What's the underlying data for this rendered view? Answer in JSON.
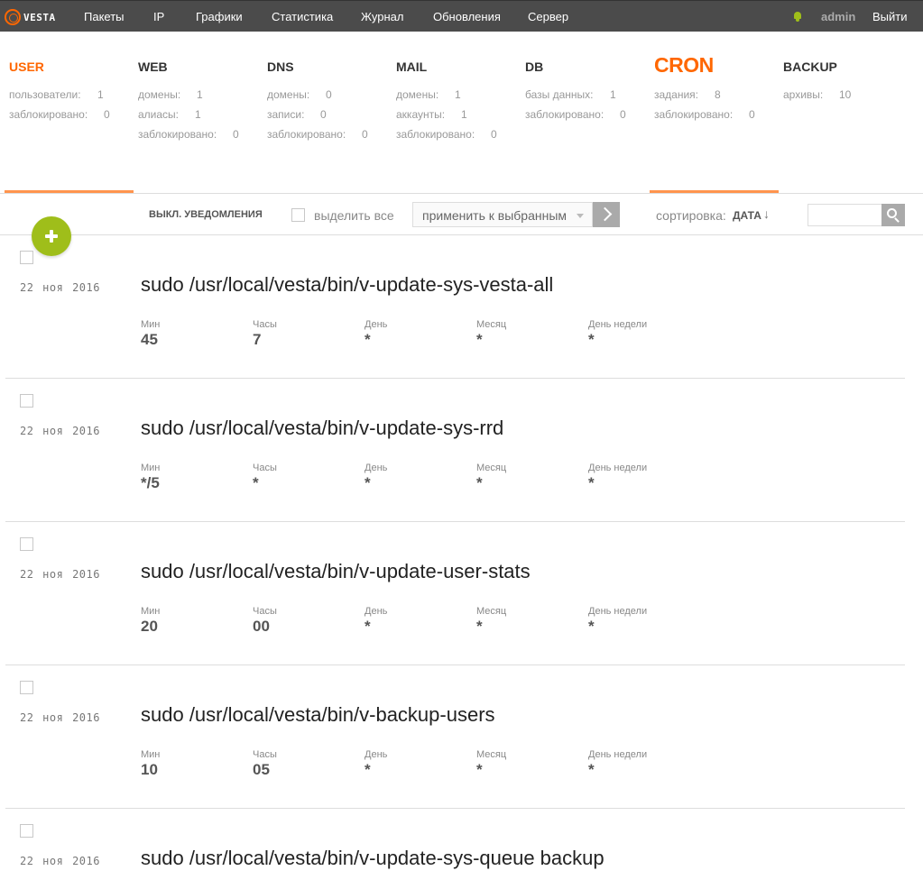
{
  "nav": {
    "logo": "VESTA",
    "items": [
      "Пакеты",
      "IP",
      "Графики",
      "Статистика",
      "Журнал",
      "Обновления",
      "Сервер"
    ],
    "user": "admin",
    "logout": "Выйти"
  },
  "panels": [
    {
      "title": "USER",
      "rows": [
        {
          "label": "пользователи:",
          "value": "1"
        },
        {
          "label": "заблокировано:",
          "value": "0"
        }
      ]
    },
    {
      "title": "WEB",
      "rows": [
        {
          "label": "домены:",
          "value": "1"
        },
        {
          "label": "алиасы:",
          "value": "1"
        },
        {
          "label": "заблокировано:",
          "value": "0"
        }
      ]
    },
    {
      "title": "DNS",
      "rows": [
        {
          "label": "домены:",
          "value": "0"
        },
        {
          "label": "записи:",
          "value": "0"
        },
        {
          "label": "заблокировано:",
          "value": "0"
        }
      ]
    },
    {
      "title": "MAIL",
      "rows": [
        {
          "label": "домены:",
          "value": "1"
        },
        {
          "label": "аккаунты:",
          "value": "1"
        },
        {
          "label": "заблокировано:",
          "value": "0"
        }
      ]
    },
    {
      "title": "DB",
      "rows": [
        {
          "label": "базы данных:",
          "value": "1"
        },
        {
          "label": "заблокировано:",
          "value": "0"
        }
      ]
    },
    {
      "title": "CRON",
      "rows": [
        {
          "label": "задания:",
          "value": "8"
        },
        {
          "label": "заблокировано:",
          "value": "0"
        }
      ]
    },
    {
      "title": "BACKUP",
      "rows": [
        {
          "label": "архивы:",
          "value": "10"
        }
      ]
    }
  ],
  "toolbar": {
    "mute": "ВЫКЛ. УВЕДОМЛЕНИЯ",
    "select_all": "выделить все",
    "apply": "применить к выбранным",
    "sort_label": "сортировка:",
    "sort_value": "ДАТА",
    "sort_arrow": "↓"
  },
  "field_labels": {
    "min": "Мин",
    "hour": "Часы",
    "day": "День",
    "month": "Месяц",
    "weekday": "День недели"
  },
  "jobs": [
    {
      "date": "22 ноя 2016",
      "cmd": "sudo /usr/local/vesta/bin/v-update-sys-vesta-all",
      "min": "45",
      "hour": "7",
      "day": "*",
      "month": "*",
      "weekday": "*"
    },
    {
      "date": "22 ноя 2016",
      "cmd": "sudo /usr/local/vesta/bin/v-update-sys-rrd",
      "min": "*/5",
      "hour": "*",
      "day": "*",
      "month": "*",
      "weekday": "*"
    },
    {
      "date": "22 ноя 2016",
      "cmd": "sudo /usr/local/vesta/bin/v-update-user-stats",
      "min": "20",
      "hour": "00",
      "day": "*",
      "month": "*",
      "weekday": "*"
    },
    {
      "date": "22 ноя 2016",
      "cmd": "sudo /usr/local/vesta/bin/v-backup-users",
      "min": "10",
      "hour": "05",
      "day": "*",
      "month": "*",
      "weekday": "*"
    },
    {
      "date": "22 ноя 2016",
      "cmd": "sudo /usr/local/vesta/bin/v-update-sys-queue backup",
      "min": "",
      "hour": "",
      "day": "",
      "month": "",
      "weekday": ""
    }
  ],
  "colors": {
    "accent": "#ff6701",
    "green": "#9fbe1a",
    "topbar": "#4b4b4b"
  }
}
